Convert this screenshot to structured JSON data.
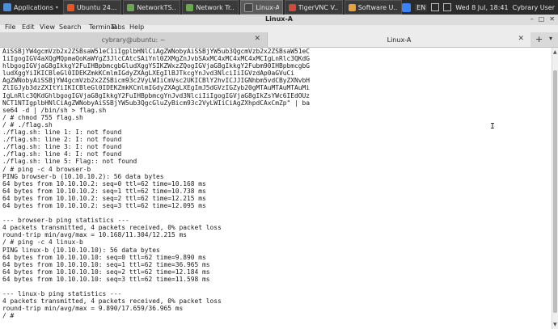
{
  "panel": {
    "applications_label": "Applications",
    "tasks": [
      {
        "label": "Ubuntu 24....",
        "color": "#e95420"
      },
      {
        "label": "NetworkTS...",
        "color": "#6aa84f"
      },
      {
        "label": "Network Tr...",
        "color": "#6aa84f"
      },
      {
        "label": "Linux-A",
        "color": "#444444"
      },
      {
        "label": "TigerVNC V...",
        "color": "#d14b3c"
      },
      {
        "label": "Software U...",
        "color": "#e9a23b"
      }
    ],
    "language": "EN",
    "datetime": "Wed  8 Jul, 18:41",
    "user": "Cybrary User"
  },
  "window": {
    "title": "Linux-A"
  },
  "menu": {
    "file": "File",
    "edit": "Edit",
    "view": "View",
    "search": "Search",
    "terminal": "Terminal",
    "tabs": "Tabs",
    "help": "Help"
  },
  "tabs": [
    {
      "label": "cybrary@ubuntu: ~",
      "active": false
    },
    {
      "label": "Linux-A",
      "active": true
    }
  ],
  "terminal": {
    "lines": [
      "AiSSBjYW4gcmVzb2x2ZSBsaW51eC1iIgplbHNlCiAgZWNobyAiSSBjYW5ub3QgcmVzb2x2ZSBsaW51eC",
      "1iIgogIGV4aXQgMQpmaQoKaWYgZ3JlcCAtcSAiYnl0ZXMgZnJvbSAxMC4xMC4xMC4xMCIgLnRlc3QKdG",
      "hlbgogIGVjaG8gIkkgY2FuIHBpbmcgbGludXggYSIKZWxzZQogIGVjaG8gIkkgY2Fubm90IHBpbmcgbG",
      "ludXggYiIKICBleGl0IDEKZmkKCmlmIGdyZXAgLXEgIlBJTkcgYnJvd3NlciIiIGVzdAp0aGVuCi",
      "AgZWNobyAiSSBjYW4gcmVzb2x2ZSBicm93c2VyLWIiCmVsc2UKICBlY2hvICJJIGNhbm5vdCByZXNvbH",
      "ZlIGJyb3dzZXItYiIKICBleGl0IDEKZmkKCmlmIGdyZXAgLXEgImJ5dGVzIGZyb20gMTAuMTAuMTAuMi",
      "IgLnRlc3QKdGhlbgogIGVjaG8gIkkgY2FuIHBpbmcgYnJvd3NlciIiIgogIGVjaG8gIkZsYWc6IEdOUz",
      "NCT1NTIgplbHNlCiAgZWNobyAiSSBjYW5ub3QgcGluZyBicm93c2VyLWIiCiAgZXhpdCAxCmZp\" | ba",
      "se64 -d | /bin/sh > flag.sh",
      "/ # chmod 755 flag.sh",
      "/ # ./flag.sh",
      "./flag.sh: line 1: I: not found",
      "./flag.sh: line 2: I: not found",
      "./flag.sh: line 3: I: not found",
      "./flag.sh: line 4: I: not found",
      "./flag.sh: line 5: Flag:: not found",
      "/ # ping -c 4 browser-b",
      "PING browser-b (10.10.10.2): 56 data bytes",
      "64 bytes from 10.10.10.2: seq=0 ttl=62 time=10.168 ms",
      "64 bytes from 10.10.10.2: seq=1 ttl=62 time=10.738 ms",
      "64 bytes from 10.10.10.2: seq=2 ttl=62 time=12.215 ms",
      "64 bytes from 10.10.10.2: seq=3 ttl=62 time=12.095 ms",
      "",
      "--- browser-b ping statistics ---",
      "4 packets transmitted, 4 packets received, 0% packet loss",
      "round-trip min/avg/max = 10.168/11.304/12.215 ms",
      "/ # ping -c 4 linux-b",
      "PING linux-b (10.10.10.10): 56 data bytes",
      "64 bytes from 10.10.10.10: seq=0 ttl=62 time=9.890 ms",
      "64 bytes from 10.10.10.10: seq=1 ttl=62 time=36.965 ms",
      "64 bytes from 10.10.10.10: seq=2 ttl=62 time=12.184 ms",
      "64 bytes from 10.10.10.10: seq=3 ttl=62 time=11.598 ms",
      "",
      "--- linux-b ping statistics ---",
      "4 packets transmitted, 4 packets received, 0% packet loss",
      "round-trip min/avg/max = 9.890/17.659/36.965 ms",
      "/ #"
    ]
  }
}
